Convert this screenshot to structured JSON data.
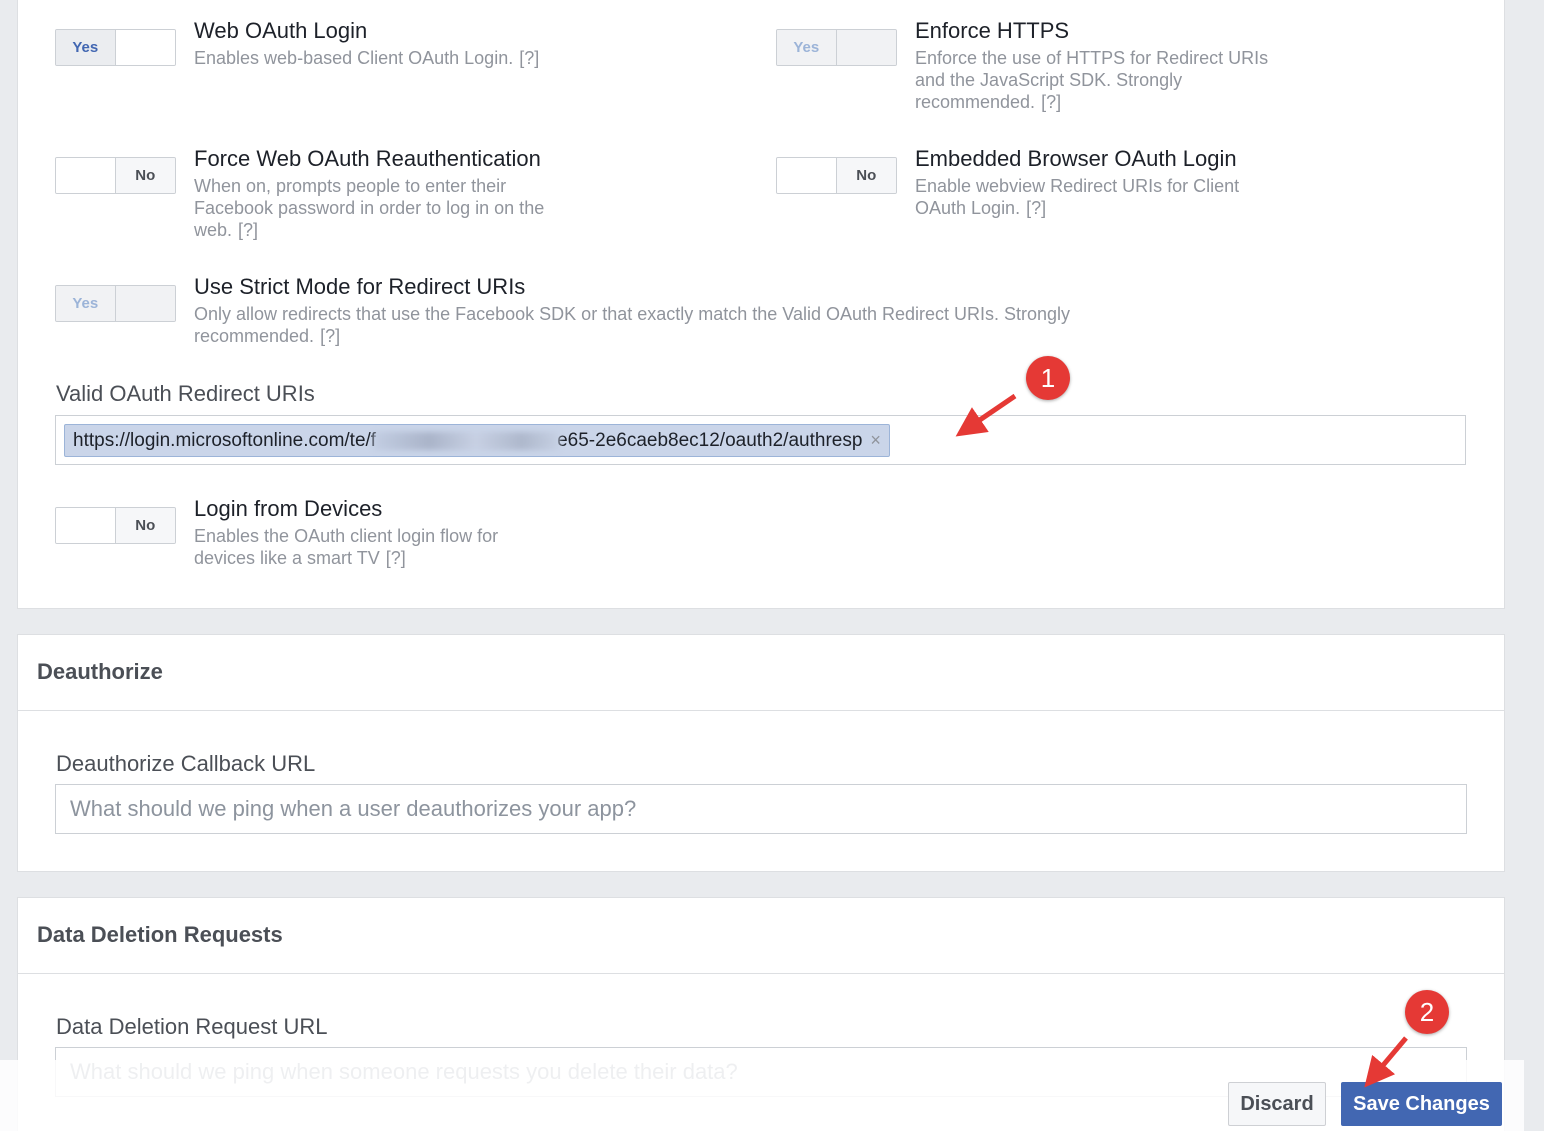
{
  "oauth_settings": {
    "web_oauth_login": {
      "title": "Web OAuth Login",
      "description": "Enables web-based Client OAuth Login.",
      "help": "[?]",
      "yes": "Yes",
      "no": ""
    },
    "enforce_https": {
      "title": "Enforce HTTPS",
      "description": "Enforce the use of HTTPS for Redirect URIs and the JavaScript SDK. Strongly recommended.",
      "help": "[?]",
      "yes": "Yes",
      "no": ""
    },
    "force_reauth": {
      "title": "Force Web OAuth Reauthentication",
      "description": "When on, prompts people to enter their Facebook password in order to log in on the web.",
      "help": "[?]",
      "yes": "",
      "no": "No"
    },
    "embedded_browser": {
      "title": "Embedded Browser OAuth Login",
      "description": "Enable webview Redirect URIs for Client OAuth Login.",
      "help": "[?]",
      "yes": "",
      "no": "No"
    },
    "strict_mode": {
      "title": "Use Strict Mode for Redirect URIs",
      "description": "Only allow redirects that use the Facebook SDK or that exactly match the Valid OAuth Redirect URIs. Strongly recommended.",
      "help": "[?]",
      "yes": "Yes",
      "no": ""
    },
    "redirect_uris": {
      "label": "Valid OAuth Redirect URIs",
      "tag_prefix": "https://login.microsoftonline.com/te/f",
      "tag_suffix": "e65-2e6caeb8ec12/oauth2/authresp",
      "remove": "×"
    },
    "login_from_devices": {
      "title": "Login from Devices",
      "description": "Enables the OAuth client login flow for devices like a smart TV",
      "help": "[?]",
      "yes": "",
      "no": "No"
    }
  },
  "deauthorize": {
    "heading": "Deauthorize",
    "label": "Deauthorize Callback URL",
    "placeholder": "What should we ping when a user deauthorizes your app?"
  },
  "data_deletion": {
    "heading": "Data Deletion Requests",
    "label": "Data Deletion Request URL",
    "placeholder": "What should we ping when someone requests you delete their data?"
  },
  "actions": {
    "discard": "Discard",
    "save": "Save Changes"
  },
  "callouts": {
    "one": "1",
    "two": "2"
  },
  "colors": {
    "accent": "#4267b2",
    "callout": "#e53935"
  }
}
